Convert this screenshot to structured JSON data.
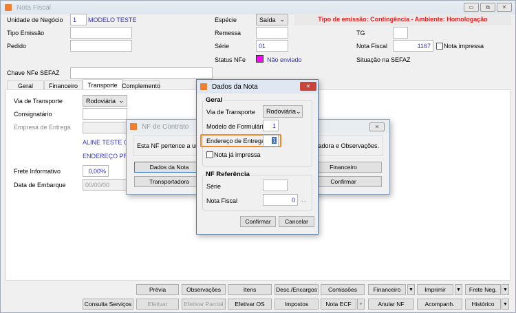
{
  "window": {
    "title": "Nota Fiscal",
    "minimize": "▭",
    "restore": "⧉",
    "close": "✕"
  },
  "header": {
    "unidade_label": "Unidade de Negócio",
    "unidade_value": "1",
    "unidade_name": "MODELO TESTE",
    "tipo_emissao_label": "Tipo Emissão",
    "tipo_emissao_value": "",
    "pedido_label": "Pedido",
    "pedido_value": "",
    "especie_label": "Espécie",
    "especie_value": "Saída",
    "banner": "Tipo de emissão: Contingência - Ambiente: Homologação",
    "remessa_label": "Remessa",
    "serie_label": "Série",
    "serie_value": "01",
    "status_label": "Status NFe",
    "status_value": "Não enviado",
    "status_color": "#ff00ff",
    "tg_label": "TG",
    "nota_fiscal_label": "Nota Fiscal",
    "nota_fiscal_value": "1167",
    "nota_impressa_label": "Nota impressa",
    "situacao_label": "Situação na SEFAZ",
    "chave_label": "Chave NFe SEFAZ"
  },
  "tabs": [
    "Geral",
    "Financeiro",
    "Transporte",
    "Complemento"
  ],
  "transporte": {
    "via_label": "Via de Transporte",
    "via_value": "Rodoviária",
    "consignatario_label": "Consignatário",
    "empresa_label": "Empresa de Entrega",
    "empresa_name": "ALINE TESTE CAR",
    "endereco": "ENDEREÇO PRINC",
    "frete_label": "Frete Informativo",
    "frete_value": "0,00%",
    "embarque_label": "Data de Embarque",
    "embarque_value": "00/00/00"
  },
  "nf_contrato": {
    "title": "NF de Contrato",
    "message_start": "Esta NF pertence a um C",
    "message_end": "rtadora e Observações.",
    "buttons": [
      "Dados da Nota",
      "Transportadora",
      "Financeiro",
      "Confirmar"
    ],
    "close": "✕"
  },
  "dados_nota": {
    "title": "Dados da Nota",
    "close": "✕",
    "geral_label": "Geral",
    "via_label": "Via de Transporte",
    "via_value": "Rodoviária",
    "modelo_label": "Modelo de Formulário",
    "modelo_value": "1",
    "endereco_label": "Endereço de Entrega",
    "endereco_value": "1",
    "nota_impressa_label": "Nota já impressa",
    "ref_label": "NF Referência",
    "serie_label": "Série",
    "nf_label": "Nota Fiscal",
    "nf_value": "0",
    "lookup": "...",
    "confirm": "Confirmar",
    "cancel": "Cancelar",
    "highlight_color": "#f08a24"
  },
  "toolbar": {
    "row1": [
      "Prévia",
      "Observações",
      "Itens",
      "Desc./Encargos",
      "Comissões",
      "Financeiro",
      "Imprimir",
      "Frete Neg."
    ],
    "row2": [
      "Consulta Serviços",
      "Efetivar",
      "Efetivar Parcial",
      "Efetivar OS",
      "Impostos",
      "Nota ECF",
      "Anular NF",
      "Acompanh.",
      "Histórico"
    ],
    "arrow": "▼"
  }
}
